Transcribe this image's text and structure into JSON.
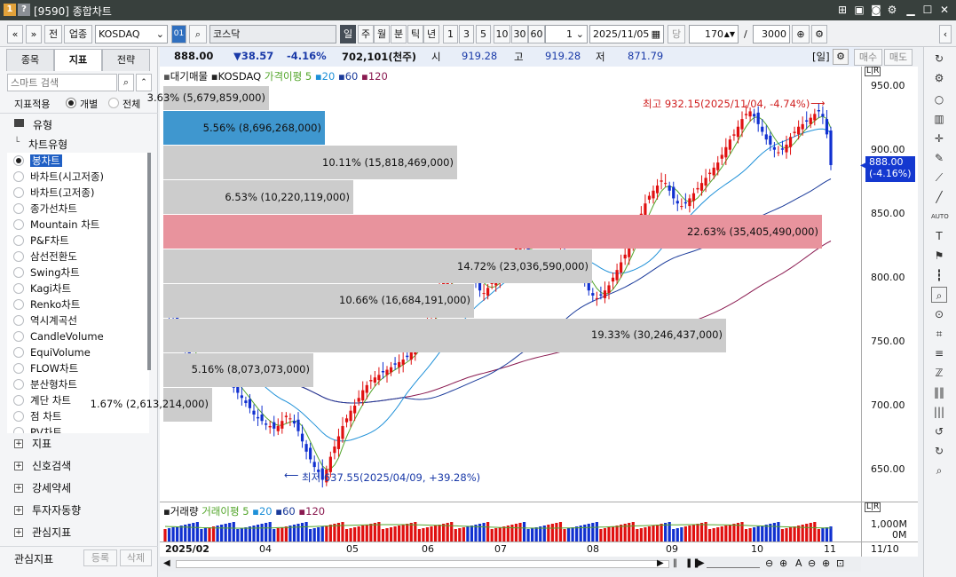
{
  "window": {
    "title": "[9590] 종합차트",
    "icon1": "1",
    "icon2": "?"
  },
  "toolbar": {
    "nav_prev": "«",
    "nav_menu": "»",
    "btn_jeon": "전",
    "sector_label": "업종",
    "index_code": "KOSDAQ",
    "badge": "01",
    "index_name": "코스닥",
    "periods": [
      "일",
      "주",
      "월",
      "분",
      "틱",
      "년"
    ],
    "active_period": "일",
    "minute_steps": [
      "1",
      "3",
      "5",
      "10",
      "30",
      "60"
    ],
    "count_box": "1",
    "date": "2025/11/05",
    "dang": "당",
    "bars": "170",
    "slash": "/",
    "total": "3000"
  },
  "left_panel": {
    "tabs": [
      "종목",
      "지표",
      "전략"
    ],
    "active_tab": "지표",
    "search_placeholder": "스마트 검색",
    "apply_label": "지표적용",
    "radio_individual": "개별",
    "radio_all": "전체",
    "type_header": "유형",
    "chart_type_group": "차트유형",
    "chart_types": [
      "봉차트",
      "바차트(시고저종)",
      "바차트(고저종)",
      "종가선차트",
      "Mountain 차트",
      "P&F차트",
      "삼선전환도",
      "Swing차트",
      "Kagi차트",
      "Renko차트",
      "역시계곡선",
      "CandleVolume",
      "EquiVolume",
      "FLOW차트",
      "분산형차트",
      "계단 차트",
      "점 차트",
      "PV차트"
    ],
    "selected_type": "봉차트",
    "groups": [
      "지표",
      "신호검색",
      "강세약세",
      "투자자동향",
      "관심지표"
    ],
    "footer_label": "관심지표",
    "btn_register": "등록",
    "btn_delete": "삭제"
  },
  "quote": {
    "price": "888.00",
    "change": "▼38.57",
    "change_pct": "-4.16%",
    "volume": "702,101(천주)",
    "open_label": "시",
    "open": "919.28",
    "high_label": "고",
    "high": "919.28",
    "low_label": "저",
    "low": "871.79",
    "period_tag": "[일]",
    "buy": "매수",
    "sell": "매도"
  },
  "legend": {
    "overlay": "대기매물",
    "name": "KOSDAQ",
    "ma_label": "가격이평",
    "ma_periods": [
      "5",
      "20",
      "60",
      "120"
    ],
    "ma_colors": [
      "#52a52a",
      "#1e90d8",
      "#1a3a9a",
      "#8a1a50"
    ]
  },
  "vol_legend": {
    "name": "거래량",
    "ma_label": "거래이평",
    "ma_periods": [
      "5",
      "20",
      "60",
      "120"
    ]
  },
  "annotations": {
    "high_text": "최고 932.15(2025/11/04, -4.74%)",
    "low_text": "최저 637.55(2025/04/09, +39.28%)"
  },
  "price_axis": {
    "labels": [
      "950.00",
      "900.00",
      "850.00",
      "800.00",
      "750.00",
      "700.00",
      "650.00"
    ],
    "current_tag": "888.00",
    "current_pct": "(-4.16%)",
    "lr": "L|R"
  },
  "vol_axis": {
    "labels": [
      "1,000M",
      "0M"
    ],
    "lr": "L|R"
  },
  "time_axis": {
    "labels": [
      "2025/02",
      "04",
      "05",
      "06",
      "07",
      "08",
      "09",
      "10",
      "11"
    ],
    "corner": "11/10"
  },
  "scroll_icons": [
    "◀",
    "▶",
    "‖",
    "❚❚",
    "▶"
  ],
  "zoom_icons": [
    "⊖",
    "⊕",
    "A",
    "⊖",
    "⊕",
    "⊡"
  ],
  "chart_data": {
    "type": "candlestick",
    "volume_profile": [
      {
        "range": [
          930,
          950
        ],
        "pct": "3.63%",
        "volume": "5,679,859,000",
        "percent": 3.63
      },
      {
        "range": [
          903,
          930
        ],
        "pct": "5.56%",
        "volume": "8,696,268,000",
        "percent": 5.56
      },
      {
        "range": [
          876,
          903
        ],
        "pct": "10.11%",
        "volume": "15,818,469,000",
        "percent": 10.11
      },
      {
        "range": [
          849,
          876
        ],
        "pct": "6.53%",
        "volume": "10,220,119,000",
        "percent": 6.53
      },
      {
        "range": [
          822,
          849
        ],
        "pct": "22.63%",
        "volume": "35,405,490,000",
        "percent": 22.63
      },
      {
        "range": [
          795,
          822
        ],
        "pct": "14.72%",
        "volume": "23,036,590,000",
        "percent": 14.72
      },
      {
        "range": [
          768,
          795
        ],
        "pct": "10.66%",
        "volume": "16,684,191,000",
        "percent": 10.66
      },
      {
        "range": [
          741,
          768
        ],
        "pct": "19.33%",
        "volume": "30,246,437,000",
        "percent": 19.33
      },
      {
        "range": [
          714,
          741
        ],
        "pct": "5.16%",
        "volume": "8,073,073,000",
        "percent": 5.16
      },
      {
        "range": [
          687,
          714
        ],
        "pct": "1.67%",
        "volume": "2,613,214,000",
        "percent": 1.67
      }
    ],
    "highlight_profile_index": 1,
    "max_profile_index": 4,
    "closes": [
      775,
      770,
      766,
      760,
      752,
      745,
      738,
      732,
      728,
      726,
      724,
      726,
      730,
      728,
      724,
      722,
      718,
      714,
      710,
      706,
      702,
      698,
      693,
      690,
      688,
      685,
      684,
      682,
      684,
      688,
      692,
      690,
      686,
      680,
      672,
      664,
      658,
      652,
      648,
      642,
      650,
      660,
      668,
      676,
      684,
      690,
      696,
      700,
      706,
      712,
      716,
      720,
      722,
      724,
      726,
      728,
      730,
      732,
      734,
      736,
      738,
      742,
      746,
      752,
      758,
      766,
      774,
      782,
      790,
      796,
      800,
      804,
      806,
      808,
      810,
      806,
      800,
      796,
      790,
      788,
      792,
      796,
      800,
      804,
      808,
      812,
      818,
      824,
      826,
      824,
      820,
      816,
      812,
      810,
      808,
      810,
      812,
      814,
      818,
      820,
      818,
      814,
      808,
      802,
      796,
      790,
      786,
      784,
      786,
      790,
      794,
      800,
      806,
      812,
      818,
      826,
      834,
      842,
      850,
      858,
      864,
      868,
      872,
      876,
      874,
      868,
      862,
      858,
      856,
      858,
      862,
      866,
      870,
      874,
      878,
      882,
      886,
      890,
      896,
      902,
      908,
      912,
      918,
      924,
      928,
      930,
      926,
      920,
      914,
      908,
      904,
      900,
      898,
      900,
      904,
      910,
      914,
      918,
      920,
      922,
      925,
      928,
      930,
      926,
      912,
      888
    ],
    "ma_note": "5/20/60/120-day moving averages",
    "vol_bars": 170,
    "price_ylim": [
      625,
      965
    ],
    "price_ticks": [
      650,
      700,
      750,
      800,
      850,
      900,
      950
    ]
  }
}
